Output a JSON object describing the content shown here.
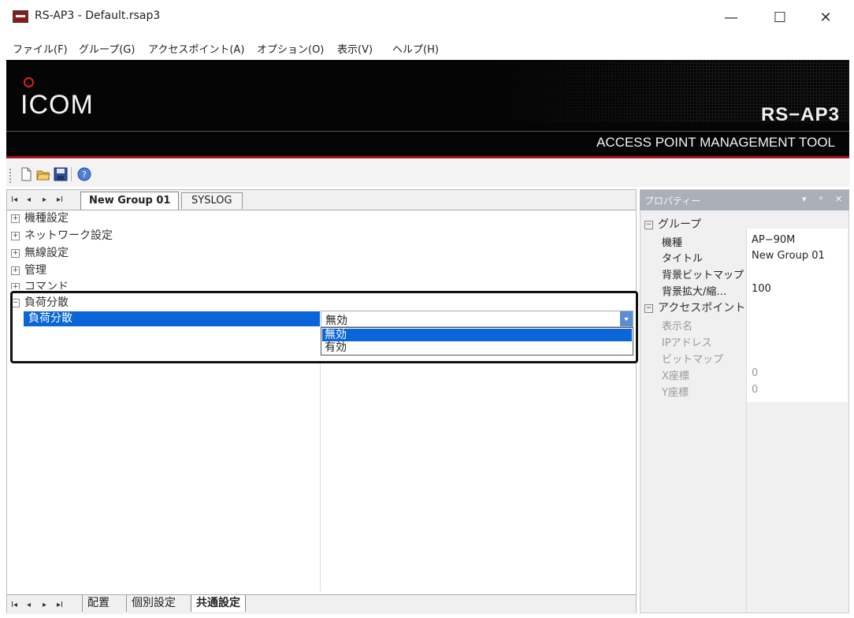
{
  "window": {
    "title": "RS-AP3 - Default.rsap3",
    "controls": {
      "minimize": "—",
      "maximize": "☐",
      "close": "✕"
    }
  },
  "menu": {
    "items": [
      "ファイル(F)",
      "グループ(G)",
      "アクセスポイント(A)",
      "オプション(O)",
      "表示(V)",
      "ヘルプ(H)"
    ]
  },
  "banner": {
    "logo": "ICOM",
    "product": "RS−AP3",
    "tagline": "ACCESS POINT MANAGEMENT TOOL"
  },
  "toolbar": {
    "icons": [
      "new-file-icon",
      "open-folder-icon",
      "save-icon",
      "help-icon"
    ]
  },
  "top_tabs": {
    "nav": [
      "I◂",
      "◂",
      "▸",
      "▸I"
    ],
    "tabs": [
      "New Group 01",
      "SYSLOG"
    ]
  },
  "tree": {
    "items": [
      "機種設定",
      "ネットワーク設定",
      "無線設定",
      "管理",
      "コマンド"
    ],
    "expanded": {
      "category": "負荷分散",
      "property": "負荷分散",
      "value": "無効",
      "options": [
        "無効",
        "有効"
      ],
      "selected_option": "無効"
    }
  },
  "bottom_tabs": {
    "nav": [
      "I◂",
      "◂",
      "▸",
      "▸I"
    ],
    "tabs": [
      "配置",
      "個別設定",
      "共通設定"
    ]
  },
  "properties": {
    "title": "プロパティー",
    "header_controls": [
      "▾",
      "ᵖ",
      "✕"
    ],
    "group": {
      "category": "グループ",
      "rows": [
        {
          "name": "機種",
          "value": "AP−90M"
        },
        {
          "name": "タイトル",
          "value": "New Group 01"
        },
        {
          "name": "背景ビットマップ",
          "value": ""
        },
        {
          "name": "背景拡大/縮…",
          "value": "100"
        }
      ]
    },
    "access_point": {
      "category": "アクセスポイント",
      "rows": [
        {
          "name": "表示名",
          "value": ""
        },
        {
          "name": "IPアドレス",
          "value": ""
        },
        {
          "name": "ビットマップ",
          "value": ""
        },
        {
          "name": "X座標",
          "value": "0"
        },
        {
          "name": "Y座標",
          "value": "0"
        }
      ]
    }
  },
  "colors": {
    "selection": "#0a66d8",
    "banner_bg": "#050505",
    "banner_accent": "#b01010",
    "panel_header": "#aab0b8"
  }
}
